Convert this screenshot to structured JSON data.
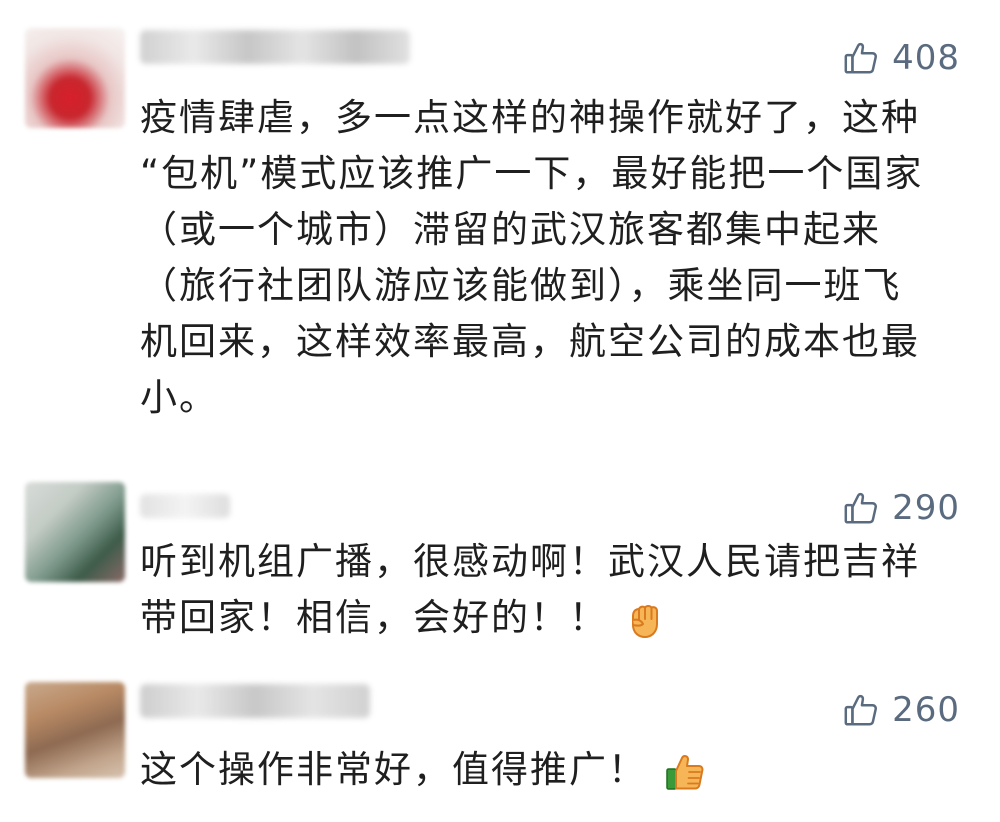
{
  "comments": [
    {
      "likes": "408",
      "lines": [
        "疫情肆虐，多一点这样的神操作就好了，这种",
        "“包机”模式应该推广一下，最好能把一个国家",
        "（或一个城市）滞留的武汉旅客都集中起来",
        "（旅行社团队游应该能做到），乘坐同一班飞",
        "机回来，这样效率最高，航空公司的成本也最",
        "小。"
      ],
      "emoji": null
    },
    {
      "likes": "290",
      "lines": [
        "听到机组广播，很感动啊！武汉人民请把吉祥",
        "带回家！相信，会好的！！"
      ],
      "emoji": "fist-emoji"
    },
    {
      "likes": "260",
      "lines": [
        "这个操作非常好，值得推广！"
      ],
      "emoji": "thumbs-up-emoji"
    }
  ],
  "icons": {
    "like": "thumb-up-outline-icon"
  },
  "colors": {
    "like_text": "#5b6b7f",
    "body_text": "#1f1f1f",
    "background": "#ffffff"
  }
}
